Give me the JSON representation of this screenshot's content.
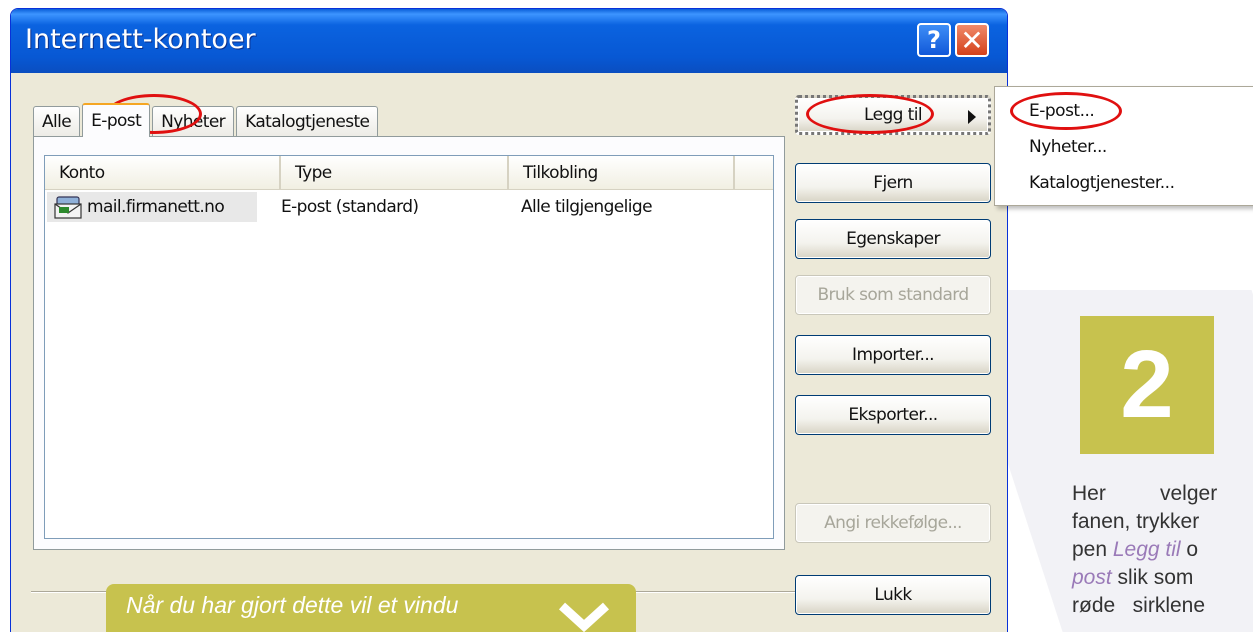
{
  "window": {
    "title": "Internett-kontoer"
  },
  "titlebar": {
    "help_glyph": "?",
    "close_glyph": "✕"
  },
  "tabs": [
    {
      "label": "Alle",
      "active": false
    },
    {
      "label": "E-post",
      "active": true
    },
    {
      "label": "Nyheter",
      "active": false
    },
    {
      "label": "Katalogtjeneste",
      "active": false
    }
  ],
  "list": {
    "columns": [
      "Konto",
      "Type",
      "Tilkobling"
    ],
    "rows": [
      {
        "account": "mail.firmanett.no",
        "type": "E-post (standard)",
        "connection": "Alle tilgjengelige",
        "icon": "mail-account-icon"
      }
    ]
  },
  "buttons": {
    "add": "Legg til",
    "remove": "Fjern",
    "properties": "Egenskaper",
    "set_default": "Bruk som standard",
    "import": "Importer...",
    "export": "Eksporter...",
    "order": "Angi rekkefølge...",
    "close": "Lukk"
  },
  "menu": {
    "items": [
      "E-post...",
      "Nyheter...",
      "Katalogtjenester..."
    ]
  },
  "guide": {
    "step": "2",
    "text_line1_a": "Her",
    "text_line1_b": "velger",
    "text_line2": "fanen, trykker",
    "text_line3_a": "pen ",
    "text_line3_em": "Legg til",
    "text_line3_b": " o",
    "text_line4_em": "post",
    "text_line4_b": " slik som",
    "text_line5": "røde   sirklene",
    "callout": "Når du har gjort dette vil et vindu"
  },
  "colors": {
    "accent_green": "#c7c24e",
    "highlight_red": "#e01010",
    "xp_blue": "#0758d4"
  }
}
